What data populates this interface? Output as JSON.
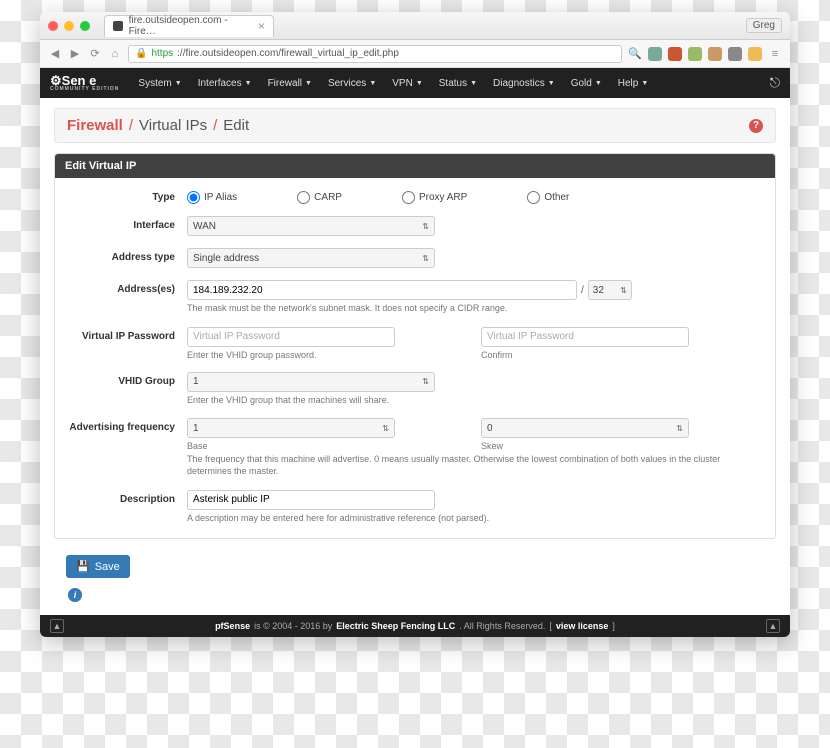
{
  "browser": {
    "tab_title": "fire.outsideopen.com - Fire…",
    "user": "Greg",
    "url_scheme": "https",
    "url_rest": "://fire.outsideopen.com/firewall_virtual_ip_edit.php"
  },
  "nav": {
    "logo": "⚙Sen e",
    "logo_sub": "COMMUNITY EDITION",
    "items": [
      "System",
      "Interfaces",
      "Firewall",
      "Services",
      "VPN",
      "Status",
      "Diagnostics",
      "Gold",
      "Help"
    ]
  },
  "breadcrumb": [
    "Firewall",
    "Virtual IPs",
    "Edit"
  ],
  "panel": {
    "title": "Edit Virtual IP"
  },
  "form": {
    "type": {
      "label": "Type",
      "options": [
        "IP Alias",
        "CARP",
        "Proxy ARP",
        "Other"
      ],
      "selected": "IP Alias"
    },
    "interface": {
      "label": "Interface",
      "value": "WAN"
    },
    "address_type": {
      "label": "Address type",
      "value": "Single address"
    },
    "addresses": {
      "label": "Address(es)",
      "value": "184.189.232.20",
      "mask": "32",
      "help": "The mask must be the network's subnet mask. It does not specify a CIDR range."
    },
    "vip_password": {
      "label": "Virtual IP Password",
      "placeholder": "Virtual IP Password",
      "help": "Enter the VHID group password.",
      "confirm_label": "Confirm"
    },
    "vhid": {
      "label": "VHID Group",
      "value": "1",
      "help": "Enter the VHID group that the machines will share."
    },
    "adv_freq": {
      "label": "Advertising frequency",
      "base_value": "1",
      "base_label": "Base",
      "skew_value": "0",
      "skew_label": "Skew",
      "help": "The frequency that this machine will advertise. 0 means usually master. Otherwise the lowest combination of both values in the cluster determines the master."
    },
    "description": {
      "label": "Description",
      "value": "Asterisk public IP",
      "help": "A description may be entered here for administrative reference (not parsed)."
    }
  },
  "buttons": {
    "save": "Save"
  },
  "footer": {
    "brand": "pfSense",
    "copy": "is © 2004 - 2016 by",
    "company": "Electric Sheep Fencing LLC",
    "rights": ". All Rights Reserved.",
    "license": "view license"
  }
}
